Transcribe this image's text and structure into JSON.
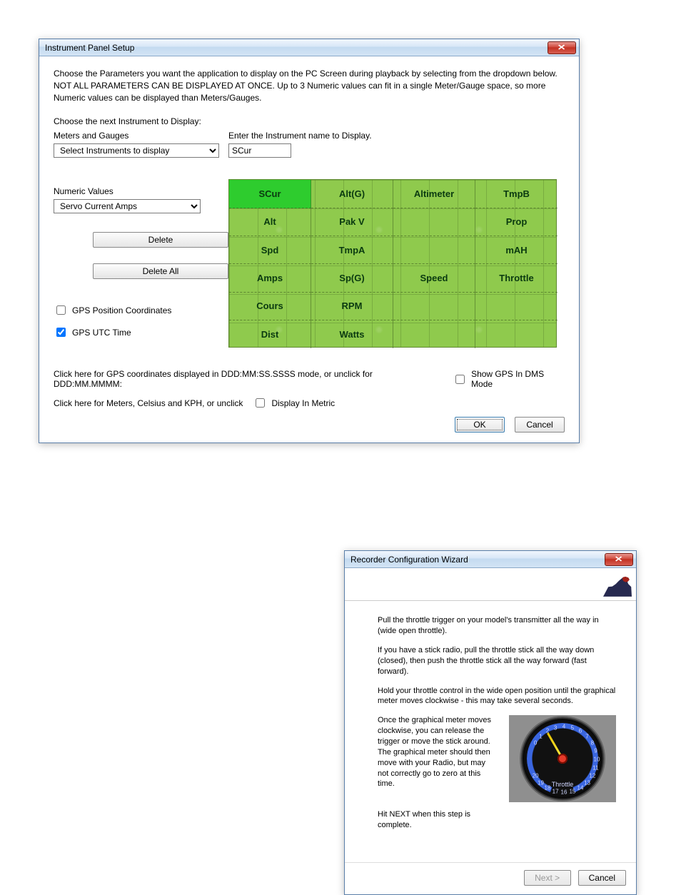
{
  "window1": {
    "title": "Instrument Panel Setup",
    "intro_line1": "Choose the Parameters  you want the application to display on the PC Screen during playback by selecting from the dropdown below.",
    "intro_line2": "NOT ALL PARAMETERS CAN BE DISPLAYED AT ONCE.  Up to 3 Numeric values can fit in a single Meter/Gauge space, so more Numeric values can be displayed than Meters/Gauges.",
    "choose_next_label": "Choose the next Instrument to Display:",
    "meters_label": "Meters and Gauges",
    "meters_selected": "Select Instruments to display",
    "enter_name_label": "Enter the Instrument name to Display.",
    "instrument_name_value": "SCur",
    "numeric_label": "Numeric Values",
    "numeric_selected": "Servo Current Amps",
    "delete_label": "Delete",
    "delete_all_label": "Delete All",
    "gps_pos_label": "GPS Position Coordinates",
    "gps_pos_checked": false,
    "gps_utc_label": "GPS UTC Time",
    "gps_utc_checked": true,
    "gps_mode_hint": "Click here for GPS coordinates displayed in DDD:MM:SS.SSSS mode, or unclick for DDD:MM.MMMM:",
    "show_gps_dms_label": "Show GPS In DMS Mode",
    "show_gps_dms_checked": false,
    "metric_hint": "Click here for Meters, Celsius and KPH, or unclick",
    "display_metric_label": "Display In Metric",
    "display_metric_checked": false,
    "ok_label": "OK",
    "cancel_label": "Cancel",
    "grid": {
      "cols": [
        [
          "SCur",
          "Alt",
          "Spd",
          "Amps",
          "Cours",
          "Dist"
        ],
        [
          "Alt(G)",
          "Pak V",
          "TmpA",
          "Sp(G)",
          "RPM",
          "Watts"
        ],
        [
          "Altimeter",
          "",
          "",
          "Speed",
          "",
          ""
        ],
        [
          "TmpB",
          "Prop",
          "mAH",
          "Throttle",
          "",
          ""
        ]
      ],
      "selected_row": 0,
      "selected_col": 0
    }
  },
  "window2": {
    "title": "Recorder Configuration Wizard",
    "p1": "Pull the throttle trigger on your model's transmitter all the way in (wide open throttle).",
    "p2": "If you have a stick radio, pull the throttle stick all the way down (closed), then push the throttle stick all the way forward (fast forward).",
    "p3": "Hold your throttle control in the wide open position until the graphical meter moves clockwise - this may take several seconds.",
    "p4": "Once the graphical meter moves clockwise, you can release the trigger or move the stick around.  The graphical meter should then move with your Radio, but may not correctly go to zero at this time.",
    "p5": "Hit NEXT when this step is complete.",
    "gauge_label": "Throttle",
    "gauge_ticks": [
      "0",
      "1",
      "2",
      "3",
      "4",
      "5",
      "6",
      "7",
      "8",
      "9",
      "10",
      "11",
      "12",
      "13",
      "14",
      "15",
      "16",
      "17",
      "18",
      "19",
      "20"
    ],
    "next_label": "Next >",
    "cancel_label": "Cancel"
  }
}
